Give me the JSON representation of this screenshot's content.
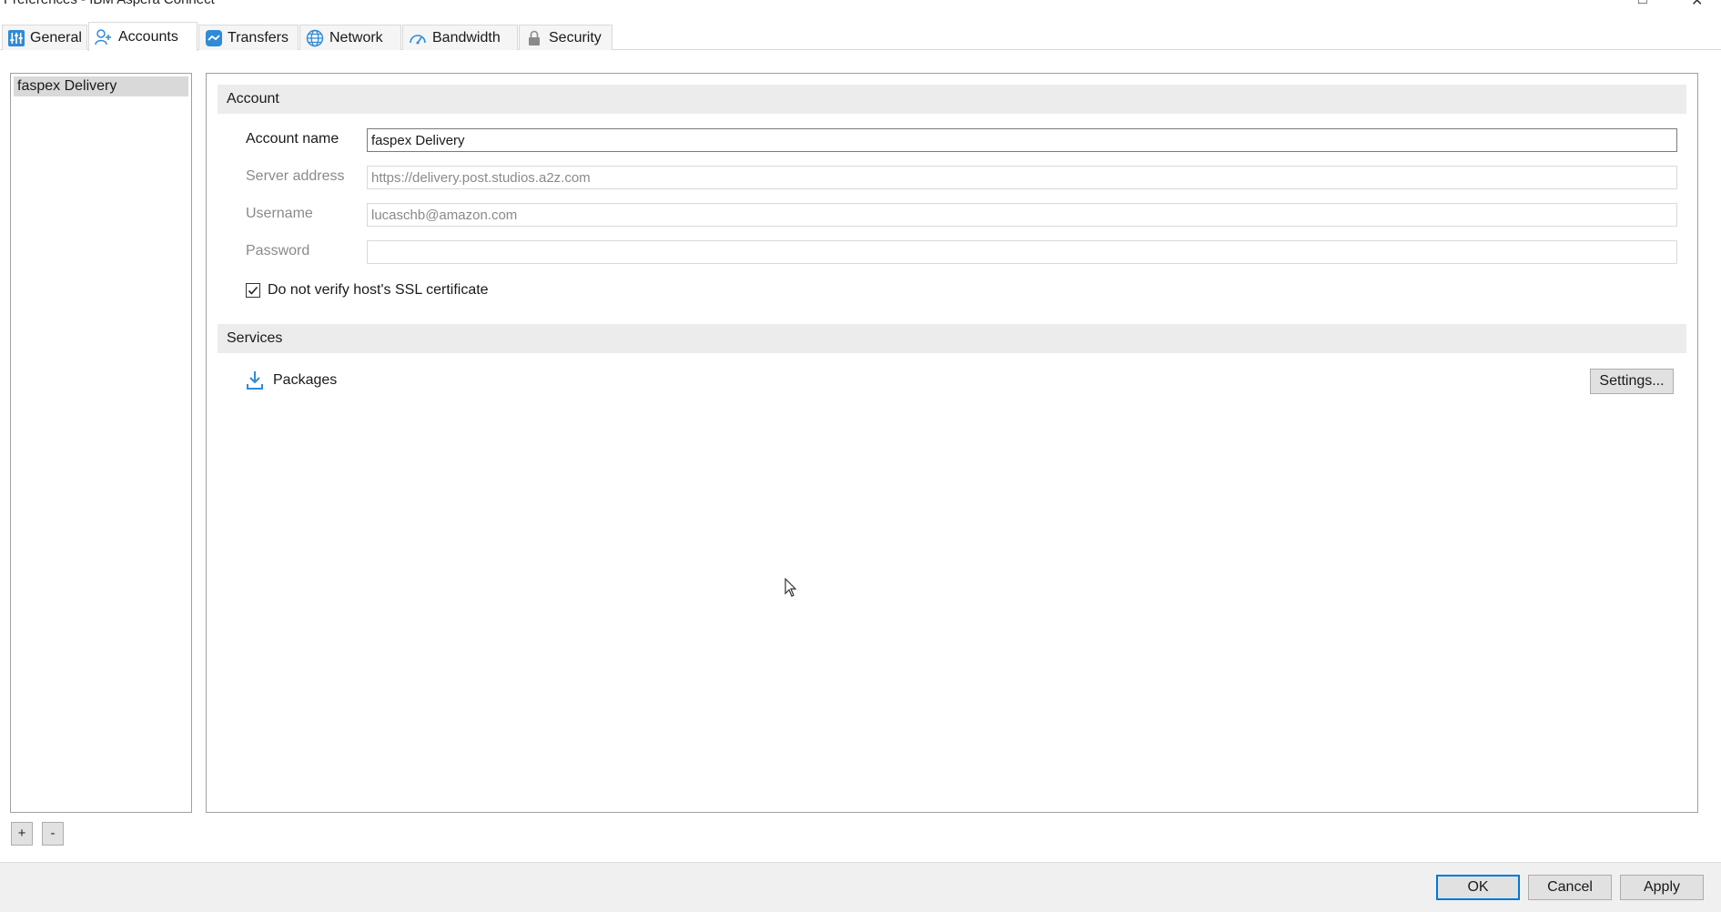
{
  "window": {
    "title": "Preferences - IBM Aspera Connect",
    "minimize_glyph": "□",
    "close_glyph": "✕"
  },
  "tabs": [
    {
      "label": "General",
      "icon": "general-icon",
      "active": false
    },
    {
      "label": "Accounts",
      "icon": "accounts-icon",
      "active": true
    },
    {
      "label": "Transfers",
      "icon": "transfers-icon",
      "active": false
    },
    {
      "label": "Network",
      "icon": "network-icon",
      "active": false
    },
    {
      "label": "Bandwidth",
      "icon": "bandwidth-icon",
      "active": false
    },
    {
      "label": "Security",
      "icon": "lock-icon",
      "active": false
    }
  ],
  "account_list": {
    "items": [
      "faspex Delivery"
    ],
    "add_label": "+",
    "remove_label": "-"
  },
  "account_section": {
    "title": "Account",
    "account_name_label": "Account name",
    "account_name_value": "faspex Delivery",
    "server_address_label": "Server address",
    "server_address_value": "https://delivery.post.studios.a2z.com",
    "username_label": "Username",
    "username_value": "lucaschb@amazon.com",
    "password_label": "Password",
    "password_value": "",
    "ssl_checkbox_label": "Do not verify host's SSL certificate",
    "ssl_checked": true
  },
  "services_section": {
    "title": "Services",
    "service_name": "Packages",
    "service_icon": "download-icon",
    "settings_label": "Settings..."
  },
  "dialog_buttons": {
    "ok": "OK",
    "cancel": "Cancel",
    "apply": "Apply"
  },
  "colors": {
    "accent": "#0078d7",
    "icon_blue": "#2f8ad8"
  }
}
